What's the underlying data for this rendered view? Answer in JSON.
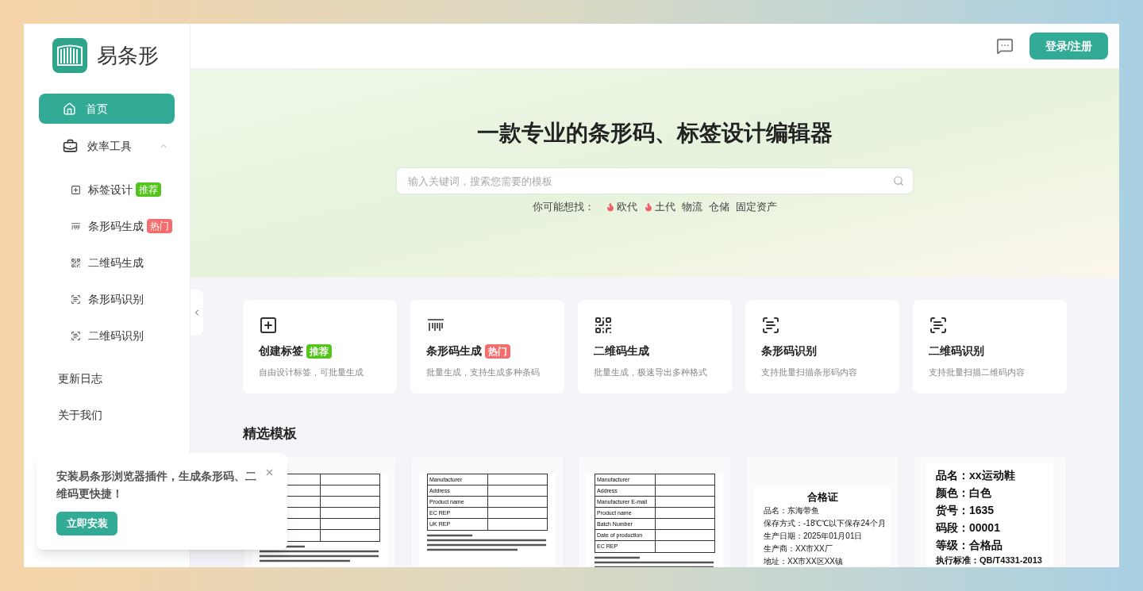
{
  "logo": {
    "name": "易条形"
  },
  "sidebar": {
    "items": [
      {
        "kind": "top",
        "label": "首页",
        "selected": true
      },
      {
        "kind": "group",
        "label": "效率工具",
        "expanded": true,
        "children": [
          {
            "label": "标签设计",
            "badge": {
              "text": "推荐",
              "color": "#52c41a"
            },
            "selected": false
          },
          {
            "label": "条形码生成",
            "badge": {
              "text": "热门",
              "color": "#f56c6c"
            },
            "selected": false
          },
          {
            "label": "二维码生成",
            "selected": false
          },
          {
            "label": "条形码识别",
            "selected": false
          },
          {
            "label": "二维码识别",
            "selected": false
          }
        ]
      },
      {
        "kind": "plain",
        "label": "更新日志",
        "selected": false
      },
      {
        "kind": "plain",
        "label": "关于我们",
        "selected": false
      }
    ]
  },
  "header": {
    "login_button": "登录/注册"
  },
  "hero": {
    "title": "一款专业的条形码、标签设计编辑器",
    "search": {
      "placeholder": "输入关键词，搜索您需要的模板"
    },
    "suggest_label": "你可能想找：",
    "suggestions": [
      {
        "text": "欧代",
        "hot": true
      },
      {
        "text": "土代",
        "hot": true
      },
      {
        "text": "物流",
        "hot": false
      },
      {
        "text": "仓储",
        "hot": false
      },
      {
        "text": "固定资产",
        "hot": false
      }
    ]
  },
  "tools": [
    {
      "title": "创建标签",
      "badge": {
        "text": "推荐",
        "color": "#52c41a"
      },
      "desc": "自由设计标签，可批量生成"
    },
    {
      "title": "条形码生成",
      "badge": {
        "text": "热门",
        "color": "#f56c6c"
      },
      "desc": "批量生成，支持生成多种条码"
    },
    {
      "title": "二维码生成",
      "desc": "批量生成，极速导出多种格式"
    },
    {
      "title": "条形码识别",
      "desc": "支持批量扫描条形码内容"
    },
    {
      "title": "二维码识别",
      "desc": "支持批量扫描二维码内容"
    }
  ],
  "templates_heading": "精选模板",
  "templates": [
    {
      "kind": "table"
    },
    {
      "kind": "table",
      "rows": [
        "Manufacturer",
        "Address",
        "Product name",
        "EC REP",
        "UK REP"
      ]
    },
    {
      "kind": "table",
      "rows": [
        "Manufacturer",
        "Address",
        "Manufacturer E-mail",
        "Product name",
        "Batch Number",
        "Date of production",
        "EC REP"
      ]
    },
    {
      "kind": "certificate",
      "title": "合格证",
      "lines": [
        "品名：东海带鱼",
        "保存方式：-18℃℃以下保存24个月",
        "生产日期：2025年01月01日",
        "生产商：XX市XX厂",
        "地址：XX市XX区XX镇"
      ]
    },
    {
      "kind": "tag",
      "lines": [
        "品名：xx运动鞋",
        "颜色：白色",
        "货号：1635",
        "码段：00001",
        "等级：合格品",
        "执行标准：QB/T4331-2013"
      ]
    }
  ],
  "popup": {
    "text": "安装易条形浏览器插件，生成条形码、二维码更快捷！",
    "button": "立即安装"
  }
}
